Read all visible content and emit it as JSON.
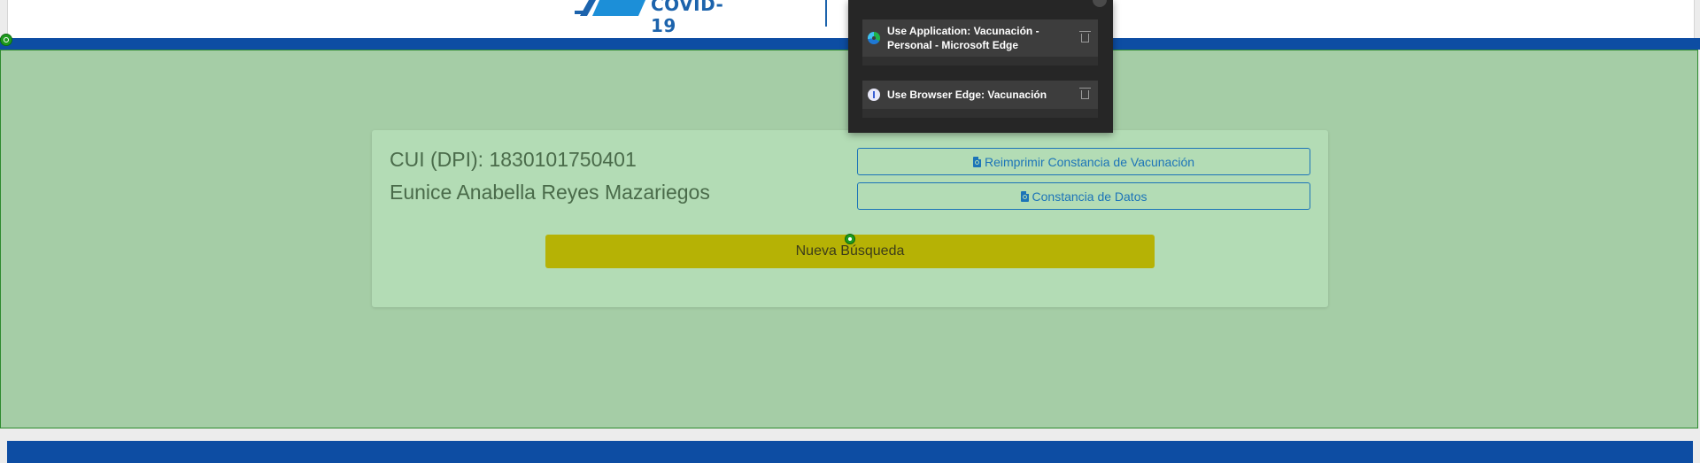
{
  "header": {
    "logo_text": "COVID-19",
    "logo_icon": "syringe-logo-icon"
  },
  "card": {
    "cui_line": "CUI (DPI): 1830101750401",
    "name_line": "Eunice Anabella Reyes Mazariegos",
    "reprint_button": "Reimprimir Constancia de Vacunación",
    "datos_button": "Constancia de Datos",
    "search_button": "Nueva Búsqueda",
    "button_icon": "file-pdf-icon"
  },
  "popup": {
    "items": [
      {
        "label": "Use Application: Vacunación - Personal - Microsoft Edge",
        "icon": "edge-browser-icon"
      },
      {
        "label": "Use Browser Edge: Vacunación",
        "icon": "info-icon"
      }
    ],
    "delete_icon": "trash-icon"
  },
  "colors": {
    "brand_blue": "#0d4da3",
    "highlight_green": "#a5cda6",
    "card_green": "#b3dcb5",
    "search_button": "#b6b205",
    "link_blue": "#1c74b8",
    "popup_bg": "#262626"
  }
}
